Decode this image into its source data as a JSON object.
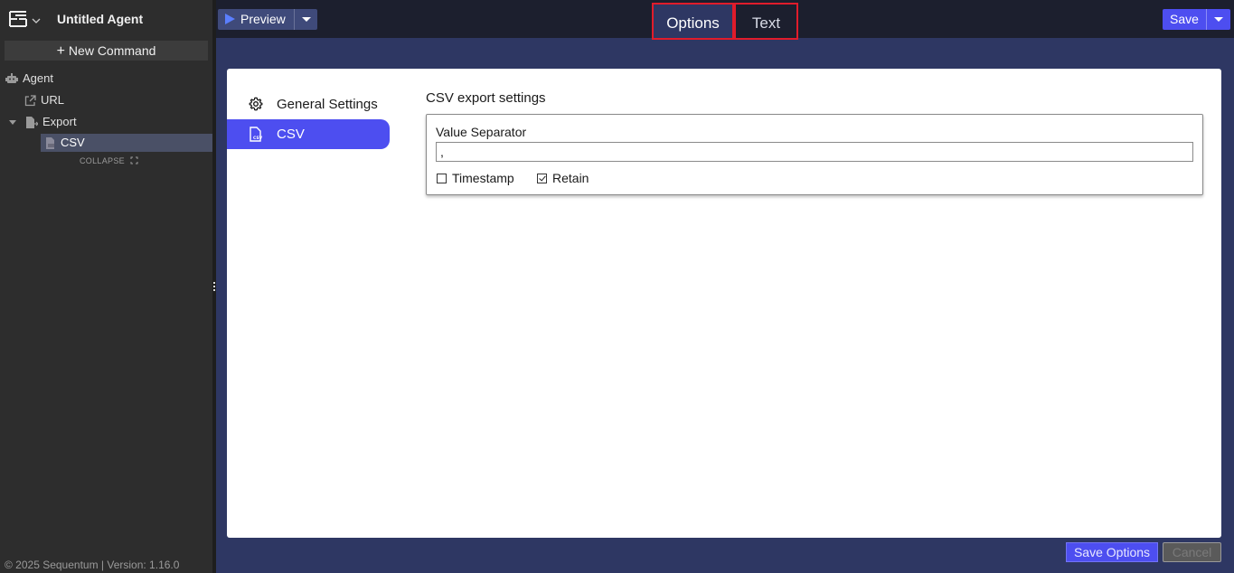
{
  "app": {
    "title": "Untitled Agent",
    "logo_icon": "sequentum-logo-icon",
    "new_command_label": "New Command",
    "footer": "© 2025 Sequentum | Version: 1.16.0"
  },
  "tree": {
    "items": [
      {
        "label": "Agent",
        "icon": "robot-icon"
      },
      {
        "label": "URL",
        "icon": "external-link-icon"
      },
      {
        "label": "Export",
        "icon": "export-file-icon",
        "expanded": true
      },
      {
        "label": "CSV",
        "icon": "csv-file-icon",
        "selected": true
      }
    ],
    "collapse_label": "COLLAPSE"
  },
  "toolbar": {
    "preview_label": "Preview",
    "save_label": "Save"
  },
  "tabs": [
    {
      "label": "Options",
      "active": true
    },
    {
      "label": "Text",
      "active": false
    }
  ],
  "settings_nav": {
    "items": [
      {
        "label": "General Settings",
        "icon": "gear-icon",
        "selected": false
      },
      {
        "label": "CSV",
        "icon": "csv-file-icon",
        "selected": true
      }
    ]
  },
  "csv_settings": {
    "title": "CSV export settings",
    "value_separator_label": "Value Separator",
    "value_separator_value": ",",
    "timestamp_label": "Timestamp",
    "timestamp_checked": false,
    "retain_label": "Retain",
    "retain_checked": true
  },
  "actions": {
    "save_options_label": "Save Options",
    "cancel_label": "Cancel"
  },
  "colors": {
    "accent": "#4d4ef0",
    "sidebar_bg": "#2d2d2d",
    "topbar_bg": "#1c1f2e",
    "main_bg": "#2e3763",
    "tab_highlight": "#e01c2b"
  }
}
